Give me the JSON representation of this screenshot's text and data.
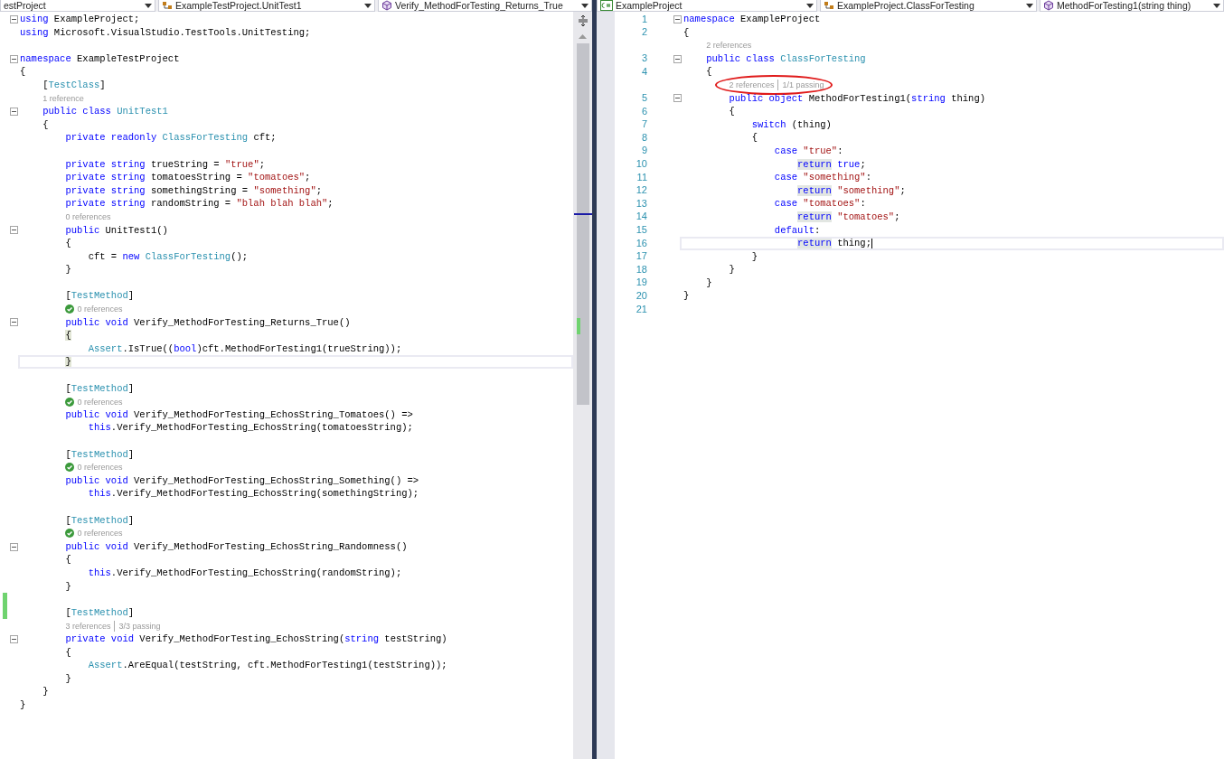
{
  "panes": [
    {
      "focused": false,
      "scrollbar": true,
      "nav": [
        {
          "text": "estProject"
        },
        {
          "kind": "class",
          "text": "ExampleTestProject.UnitTest1"
        },
        {
          "kind": "method",
          "text": "Verify_MethodForTesting_Returns_True"
        }
      ],
      "lines": [
        {
          "kind": "code",
          "fold": true,
          "current": false,
          "changed": false,
          "tokens": [
            {
              "text": "using",
              "kind": "kw"
            },
            {
              "text": " ExampleProject;",
              "kind": "p"
            }
          ]
        },
        {
          "kind": "code",
          "fold": false,
          "current": false,
          "changed": false,
          "tokens": [
            {
              "text": "using",
              "kind": "kw"
            },
            {
              "text": " Microsoft.VisualStudio.TestTools.UnitTesting;",
              "kind": "p"
            }
          ]
        },
        {
          "kind": "code",
          "fold": false,
          "current": false,
          "changed": false
        },
        {
          "kind": "code",
          "fold": true,
          "current": false,
          "changed": false,
          "tokens": [
            {
              "text": "namespace",
              "kind": "kw"
            },
            {
              "text": " ExampleTestProject",
              "kind": "p"
            }
          ]
        },
        {
          "kind": "code",
          "fold": false,
          "current": false,
          "changed": false,
          "tokens": [
            {
              "text": "{",
              "kind": "p"
            }
          ]
        },
        {
          "kind": "code",
          "fold": false,
          "current": false,
          "changed": false,
          "tokens": [
            {
              "text": "    [",
              "kind": "p"
            },
            {
              "text": "TestClass",
              "kind": "type"
            },
            {
              "text": "]",
              "kind": "p"
            }
          ]
        },
        {
          "kind": "lens",
          "check": false,
          "circled": false,
          "parts": [
            "1 reference"
          ]
        },
        {
          "kind": "code",
          "fold": true,
          "current": false,
          "changed": false,
          "tokens": [
            {
              "text": "    public class ",
              "kind": "kw"
            },
            {
              "text": "UnitTest1",
              "kind": "type"
            }
          ]
        },
        {
          "kind": "code",
          "fold": false,
          "current": false,
          "changed": false,
          "tokens": [
            {
              "text": "    {",
              "kind": "p"
            }
          ]
        },
        {
          "kind": "code",
          "fold": false,
          "current": false,
          "changed": false,
          "tokens": [
            {
              "text": "        private readonly ",
              "kind": "kw"
            },
            {
              "text": "ClassForTesting",
              "kind": "type"
            },
            {
              "text": " cft;",
              "kind": "p"
            }
          ]
        },
        {
          "kind": "code",
          "fold": false,
          "current": false,
          "changed": false
        },
        {
          "kind": "code",
          "fold": false,
          "current": false,
          "changed": false,
          "tokens": [
            {
              "text": "        private string",
              "kind": "kw"
            },
            {
              "text": " trueString = ",
              "kind": "p"
            },
            {
              "text": "\"true\"",
              "kind": "str"
            },
            {
              "text": ";",
              "kind": "p"
            }
          ]
        },
        {
          "kind": "code",
          "fold": false,
          "current": false,
          "changed": false,
          "tokens": [
            {
              "text": "        private string",
              "kind": "kw"
            },
            {
              "text": " tomatoesString = ",
              "kind": "p"
            },
            {
              "text": "\"tomatoes\"",
              "kind": "str"
            },
            {
              "text": ";",
              "kind": "p"
            }
          ]
        },
        {
          "kind": "code",
          "fold": false,
          "current": false,
          "changed": false,
          "tokens": [
            {
              "text": "        private string",
              "kind": "kw"
            },
            {
              "text": " somethingString = ",
              "kind": "p"
            },
            {
              "text": "\"something\"",
              "kind": "str"
            },
            {
              "text": ";",
              "kind": "p"
            }
          ]
        },
        {
          "kind": "code",
          "fold": false,
          "current": false,
          "changed": false,
          "tokens": [
            {
              "text": "        private string",
              "kind": "kw"
            },
            {
              "text": " randomString = ",
              "kind": "p"
            },
            {
              "text": "\"blah blah blah\"",
              "kind": "str"
            },
            {
              "text": ";",
              "kind": "p"
            }
          ]
        },
        {
          "kind": "lens",
          "check": false,
          "circled": false,
          "parts": [
            "0 references"
          ]
        },
        {
          "kind": "code",
          "fold": true,
          "current": false,
          "changed": false,
          "tokens": [
            {
              "text": "        public",
              "kind": "kw"
            },
            {
              "text": " UnitTest1()",
              "kind": "p"
            }
          ]
        },
        {
          "kind": "code",
          "fold": false,
          "current": false,
          "changed": false,
          "tokens": [
            {
              "text": "        {",
              "kind": "p"
            }
          ]
        },
        {
          "kind": "code",
          "fold": false,
          "current": false,
          "changed": false,
          "tokens": [
            {
              "text": "            cft = ",
              "kind": "p"
            },
            {
              "text": "new ",
              "kind": "kw"
            },
            {
              "text": "ClassForTesting",
              "kind": "type"
            },
            {
              "text": "();",
              "kind": "p"
            }
          ]
        },
        {
          "kind": "code",
          "fold": false,
          "current": false,
          "changed": false,
          "tokens": [
            {
              "text": "        }",
              "kind": "p"
            }
          ]
        },
        {
          "kind": "code",
          "fold": false,
          "current": false,
          "changed": false
        },
        {
          "kind": "code",
          "fold": false,
          "current": false,
          "changed": false,
          "tokens": [
            {
              "text": "        [",
              "kind": "p"
            },
            {
              "text": "TestMethod",
              "kind": "type"
            },
            {
              "text": "]",
              "kind": "p"
            }
          ]
        },
        {
          "kind": "lens",
          "check": true,
          "circled": false,
          "parts": [
            "0 references"
          ]
        },
        {
          "kind": "code",
          "fold": true,
          "current": false,
          "changed": false,
          "tokens": [
            {
              "text": "        public void",
              "kind": "kw"
            },
            {
              "text": " Verify_MethodForTesting_Returns_True()",
              "kind": "p"
            }
          ]
        },
        {
          "kind": "code",
          "fold": false,
          "current": false,
          "changed": false,
          "tokens": [
            {
              "text": "        {",
              "kind": "match"
            }
          ]
        },
        {
          "kind": "code",
          "fold": false,
          "current": false,
          "changed": false,
          "tokens": [
            {
              "text": "            Assert",
              "kind": "type"
            },
            {
              "text": ".IsTrue((",
              "kind": "p"
            },
            {
              "text": "bool",
              "kind": "kw"
            },
            {
              "text": ")cft.MethodForTesting1(trueString));",
              "kind": "p"
            }
          ]
        },
        {
          "kind": "code",
          "fold": false,
          "current": true,
          "changed": false,
          "tokens": [
            {
              "text": "        }",
              "kind": "match"
            }
          ]
        },
        {
          "kind": "code",
          "fold": false,
          "current": false,
          "changed": false
        },
        {
          "kind": "code",
          "fold": false,
          "current": false,
          "changed": false,
          "tokens": [
            {
              "text": "        [",
              "kind": "p"
            },
            {
              "text": "TestMethod",
              "kind": "type"
            },
            {
              "text": "]",
              "kind": "p"
            }
          ]
        },
        {
          "kind": "lens",
          "check": true,
          "circled": false,
          "parts": [
            "0 references"
          ]
        },
        {
          "kind": "code",
          "fold": false,
          "current": false,
          "changed": false,
          "tokens": [
            {
              "text": "        public void",
              "kind": "kw"
            },
            {
              "text": " Verify_MethodForTesting_EchosString_Tomatoes() =>",
              "kind": "p"
            }
          ]
        },
        {
          "kind": "code",
          "fold": false,
          "current": false,
          "changed": false,
          "tokens": [
            {
              "text": "            this",
              "kind": "kw"
            },
            {
              "text": ".Verify_MethodForTesting_EchosString(tomatoesString);",
              "kind": "p"
            }
          ]
        },
        {
          "kind": "code",
          "fold": false,
          "current": false,
          "changed": false
        },
        {
          "kind": "code",
          "fold": false,
          "current": false,
          "changed": false,
          "tokens": [
            {
              "text": "        [",
              "kind": "p"
            },
            {
              "text": "TestMethod",
              "kind": "type"
            },
            {
              "text": "]",
              "kind": "p"
            }
          ]
        },
        {
          "kind": "lens",
          "check": true,
          "circled": false,
          "parts": [
            "0 references"
          ]
        },
        {
          "kind": "code",
          "fold": false,
          "current": false,
          "changed": false,
          "tokens": [
            {
              "text": "        public void",
              "kind": "kw"
            },
            {
              "text": " Verify_MethodForTesting_EchosString_Something() =>",
              "kind": "p"
            }
          ]
        },
        {
          "kind": "code",
          "fold": false,
          "current": false,
          "changed": false,
          "tokens": [
            {
              "text": "            this",
              "kind": "kw"
            },
            {
              "text": ".Verify_MethodForTesting_EchosString(somethingString);",
              "kind": "p"
            }
          ]
        },
        {
          "kind": "code",
          "fold": false,
          "current": false,
          "changed": false
        },
        {
          "kind": "code",
          "fold": false,
          "current": false,
          "changed": false,
          "tokens": [
            {
              "text": "        [",
              "kind": "p"
            },
            {
              "text": "TestMethod",
              "kind": "type"
            },
            {
              "text": "]",
              "kind": "p"
            }
          ]
        },
        {
          "kind": "lens",
          "check": true,
          "circled": false,
          "parts": [
            "0 references"
          ]
        },
        {
          "kind": "code",
          "fold": true,
          "current": false,
          "changed": false,
          "tokens": [
            {
              "text": "        public void",
              "kind": "kw"
            },
            {
              "text": " Verify_MethodForTesting_EchosString_Randomness()",
              "kind": "p"
            }
          ]
        },
        {
          "kind": "code",
          "fold": false,
          "current": false,
          "changed": false,
          "tokens": [
            {
              "text": "        {",
              "kind": "p"
            }
          ]
        },
        {
          "kind": "code",
          "fold": false,
          "current": false,
          "changed": false,
          "tokens": [
            {
              "text": "            this",
              "kind": "kw"
            },
            {
              "text": ".Verify_MethodForTesting_EchosString(randomString);",
              "kind": "p"
            }
          ]
        },
        {
          "kind": "code",
          "fold": false,
          "current": false,
          "changed": false,
          "tokens": [
            {
              "text": "        }",
              "kind": "p"
            }
          ]
        },
        {
          "kind": "code",
          "fold": false,
          "current": false,
          "changed": true
        },
        {
          "kind": "code",
          "fold": false,
          "current": false,
          "changed": true,
          "tokens": [
            {
              "text": "        [",
              "kind": "p"
            },
            {
              "text": "TestMethod",
              "kind": "type"
            },
            {
              "text": "]",
              "kind": "p"
            }
          ]
        },
        {
          "kind": "lens",
          "check": false,
          "circled": false,
          "parts": [
            "3 references",
            "3/3 passing"
          ]
        },
        {
          "kind": "code",
          "fold": true,
          "current": false,
          "changed": false,
          "tokens": [
            {
              "text": "        private void",
              "kind": "kw"
            },
            {
              "text": " Verify_MethodForTesting_EchosString(",
              "kind": "p"
            },
            {
              "text": "string",
              "kind": "kw"
            },
            {
              "text": " testString)",
              "kind": "p"
            }
          ]
        },
        {
          "kind": "code",
          "fold": false,
          "current": false,
          "changed": false,
          "tokens": [
            {
              "text": "        {",
              "kind": "p"
            }
          ]
        },
        {
          "kind": "code",
          "fold": false,
          "current": false,
          "changed": false,
          "tokens": [
            {
              "text": "            Assert",
              "kind": "type"
            },
            {
              "text": ".AreEqual(testString, cft.MethodForTesting1(testString));",
              "kind": "p"
            }
          ]
        },
        {
          "kind": "code",
          "fold": false,
          "current": false,
          "changed": false,
          "tokens": [
            {
              "text": "        }",
              "kind": "p"
            }
          ]
        },
        {
          "kind": "code",
          "fold": false,
          "current": false,
          "changed": false,
          "tokens": [
            {
              "text": "    }",
              "kind": "p"
            }
          ]
        },
        {
          "kind": "code",
          "fold": false,
          "current": false,
          "changed": false,
          "tokens": [
            {
              "text": "}",
              "kind": "p"
            }
          ]
        }
      ]
    },
    {
      "focused": true,
      "scrollbar": false,
      "nav": [
        {
          "kind": "csproject",
          "text": "ExampleProject"
        },
        {
          "kind": "class",
          "text": "ExampleProject.ClassForTesting"
        },
        {
          "kind": "method",
          "text": "MethodForTesting1(string thing)"
        }
      ],
      "lines": [
        {
          "kind": "code",
          "number": "1",
          "fold": true,
          "current": false,
          "changed": false,
          "tokens": [
            {
              "text": "namespace",
              "kind": "kw"
            },
            {
              "text": " ExampleProject",
              "kind": "p"
            }
          ]
        },
        {
          "kind": "code",
          "number": "2",
          "fold": false,
          "current": false,
          "changed": false,
          "tokens": [
            {
              "text": "{",
              "kind": "p"
            }
          ]
        },
        {
          "kind": "lens",
          "check": false,
          "circled": false,
          "parts": [
            "2 references"
          ]
        },
        {
          "kind": "code",
          "number": "3",
          "fold": true,
          "current": false,
          "changed": false,
          "tokens": [
            {
              "text": "    public class ",
              "kind": "kw"
            },
            {
              "text": "ClassForTesting",
              "kind": "type"
            }
          ]
        },
        {
          "kind": "code",
          "number": "4",
          "fold": false,
          "current": false,
          "changed": false,
          "tokens": [
            {
              "text": "    {",
              "kind": "p"
            }
          ]
        },
        {
          "kind": "lens",
          "check": false,
          "circled": true,
          "parts": [
            "2 references",
            "1/1 passing"
          ]
        },
        {
          "kind": "code",
          "number": "5",
          "fold": true,
          "current": false,
          "changed": false,
          "tokens": [
            {
              "text": "        public object",
              "kind": "kw"
            },
            {
              "text": " MethodForTesting1(",
              "kind": "p"
            },
            {
              "text": "string",
              "kind": "kw"
            },
            {
              "text": " thing)",
              "kind": "p"
            }
          ]
        },
        {
          "kind": "code",
          "number": "6",
          "fold": false,
          "current": false,
          "changed": false,
          "tokens": [
            {
              "text": "        {",
              "kind": "p"
            }
          ]
        },
        {
          "kind": "code",
          "number": "7",
          "fold": false,
          "current": false,
          "changed": false,
          "tokens": [
            {
              "text": "            switch",
              "kind": "kw"
            },
            {
              "text": " (thing)",
              "kind": "p"
            }
          ]
        },
        {
          "kind": "code",
          "number": "8",
          "fold": false,
          "current": false,
          "changed": false,
          "tokens": [
            {
              "text": "            {",
              "kind": "p"
            }
          ]
        },
        {
          "kind": "code",
          "number": "9",
          "fold": false,
          "current": false,
          "changed": false,
          "tokens": [
            {
              "text": "                case",
              "kind": "kw"
            },
            {
              "text": " \"true\"",
              "kind": "str"
            },
            {
              "text": ":",
              "kind": "p"
            }
          ]
        },
        {
          "kind": "code",
          "number": "10",
          "fold": false,
          "current": false,
          "changed": false,
          "tokens": [
            {
              "text": "                    return",
              "kind": "ref"
            },
            {
              "text": " true",
              "kind": "kw"
            },
            {
              "text": ";",
              "kind": "p"
            }
          ]
        },
        {
          "kind": "code",
          "number": "11",
          "fold": false,
          "current": false,
          "changed": false,
          "tokens": [
            {
              "text": "                case",
              "kind": "kw"
            },
            {
              "text": " \"something\"",
              "kind": "str"
            },
            {
              "text": ":",
              "kind": "p"
            }
          ]
        },
        {
          "kind": "code",
          "number": "12",
          "fold": false,
          "current": false,
          "changed": false,
          "tokens": [
            {
              "text": "                    return",
              "kind": "ref"
            },
            {
              "text": " \"something\"",
              "kind": "str"
            },
            {
              "text": ";",
              "kind": "p"
            }
          ]
        },
        {
          "kind": "code",
          "number": "13",
          "fold": false,
          "current": false,
          "changed": false,
          "tokens": [
            {
              "text": "                case",
              "kind": "kw"
            },
            {
              "text": " \"tomatoes\"",
              "kind": "str"
            },
            {
              "text": ":",
              "kind": "p"
            }
          ]
        },
        {
          "kind": "code",
          "number": "14",
          "fold": false,
          "current": false,
          "changed": false,
          "tokens": [
            {
              "text": "                    return",
              "kind": "ref"
            },
            {
              "text": " \"tomatoes\"",
              "kind": "str"
            },
            {
              "text": ";",
              "kind": "p"
            }
          ]
        },
        {
          "kind": "code",
          "number": "15",
          "fold": false,
          "current": false,
          "changed": false,
          "tokens": [
            {
              "text": "                default",
              "kind": "kw"
            },
            {
              "text": ":",
              "kind": "p"
            }
          ]
        },
        {
          "kind": "code",
          "number": "16",
          "fold": false,
          "current": true,
          "changed": false,
          "tokens": [
            {
              "text": "                    return",
              "kind": "ref"
            },
            {
              "text": " thing;",
              "kind": "p"
            }
          ]
        },
        {
          "kind": "code",
          "number": "17",
          "fold": false,
          "current": false,
          "changed": false,
          "tokens": [
            {
              "text": "            }",
              "kind": "p"
            }
          ]
        },
        {
          "kind": "code",
          "number": "18",
          "fold": false,
          "current": false,
          "changed": false,
          "tokens": [
            {
              "text": "        }",
              "kind": "p"
            }
          ]
        },
        {
          "kind": "code",
          "number": "19",
          "fold": false,
          "current": false,
          "changed": false,
          "tokens": [
            {
              "text": "    }",
              "kind": "p"
            }
          ]
        },
        {
          "kind": "code",
          "number": "20",
          "fold": false,
          "current": false,
          "changed": false,
          "tokens": [
            {
              "text": "}",
              "kind": "p"
            }
          ]
        },
        {
          "kind": "code",
          "number": "21",
          "fold": false,
          "current": false,
          "changed": false
        }
      ]
    }
  ]
}
